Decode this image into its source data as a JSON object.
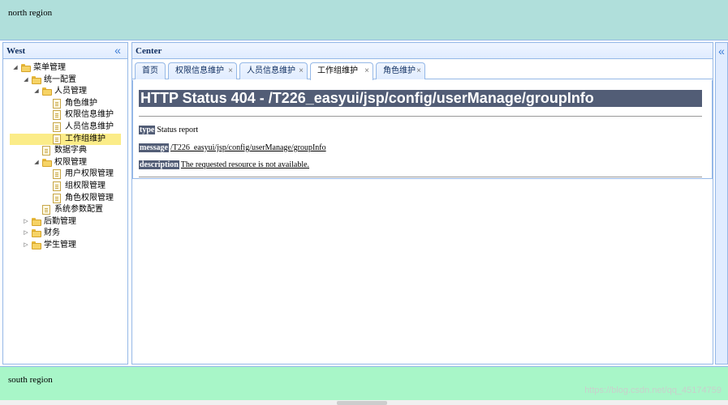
{
  "north": {
    "text": "north region"
  },
  "south": {
    "text": "south region"
  },
  "watermark": "https://blog.csdn.net/qq_45174759",
  "west": {
    "title": "West",
    "collapse_icon": "«"
  },
  "center": {
    "title": "Center"
  },
  "east": {
    "collapse_icon": "«"
  },
  "tree": [
    {
      "label": "菜单管理",
      "type": "folder",
      "expanded": true
    },
    {
      "label": "统一配置",
      "type": "folder",
      "expanded": true
    },
    {
      "label": "人员管理",
      "type": "folder",
      "expanded": true
    },
    {
      "label": "角色维护",
      "type": "file"
    },
    {
      "label": "权限信息维护",
      "type": "file"
    },
    {
      "label": "人员信息维护",
      "type": "file"
    },
    {
      "label": "工作组维护",
      "type": "file",
      "selected": true
    },
    {
      "label": "数据字典",
      "type": "file"
    },
    {
      "label": "权限管理",
      "type": "folder",
      "expanded": true
    },
    {
      "label": "用户权限管理",
      "type": "file"
    },
    {
      "label": "组权限管理",
      "type": "file"
    },
    {
      "label": "角色权限管理",
      "type": "file"
    },
    {
      "label": "系统参数配置",
      "type": "file"
    },
    {
      "label": "后勤管理",
      "type": "folder",
      "expanded": false
    },
    {
      "label": "财务",
      "type": "folder",
      "expanded": false
    },
    {
      "label": "学生管理",
      "type": "folder",
      "expanded": false
    }
  ],
  "tabs": [
    {
      "label": "首页",
      "closable": false
    },
    {
      "label": "权限信息维护",
      "closable": true
    },
    {
      "label": "人员信息维护",
      "closable": true
    },
    {
      "label": "工作组维护",
      "closable": true,
      "active": true
    },
    {
      "label": "角色维护",
      "closable": true
    }
  ],
  "tab_close_glyph": "×",
  "error": {
    "title": "HTTP Status 404 - /T226_easyui/jsp/config/userManage/groupInfo",
    "type_key": "type",
    "type_val": "Status report",
    "message_key": "message",
    "message_val": "/T226_easyui/jsp/config/userManage/groupInfo",
    "description_key": "description",
    "description_val": "The requested resource is not available."
  },
  "colors": {
    "north_bg": "#b0dfdb",
    "south_bg": "#a8f6c8",
    "panel_border": "#95b8e7",
    "selected_bg": "#fbec88",
    "error_header": "#525d76"
  }
}
